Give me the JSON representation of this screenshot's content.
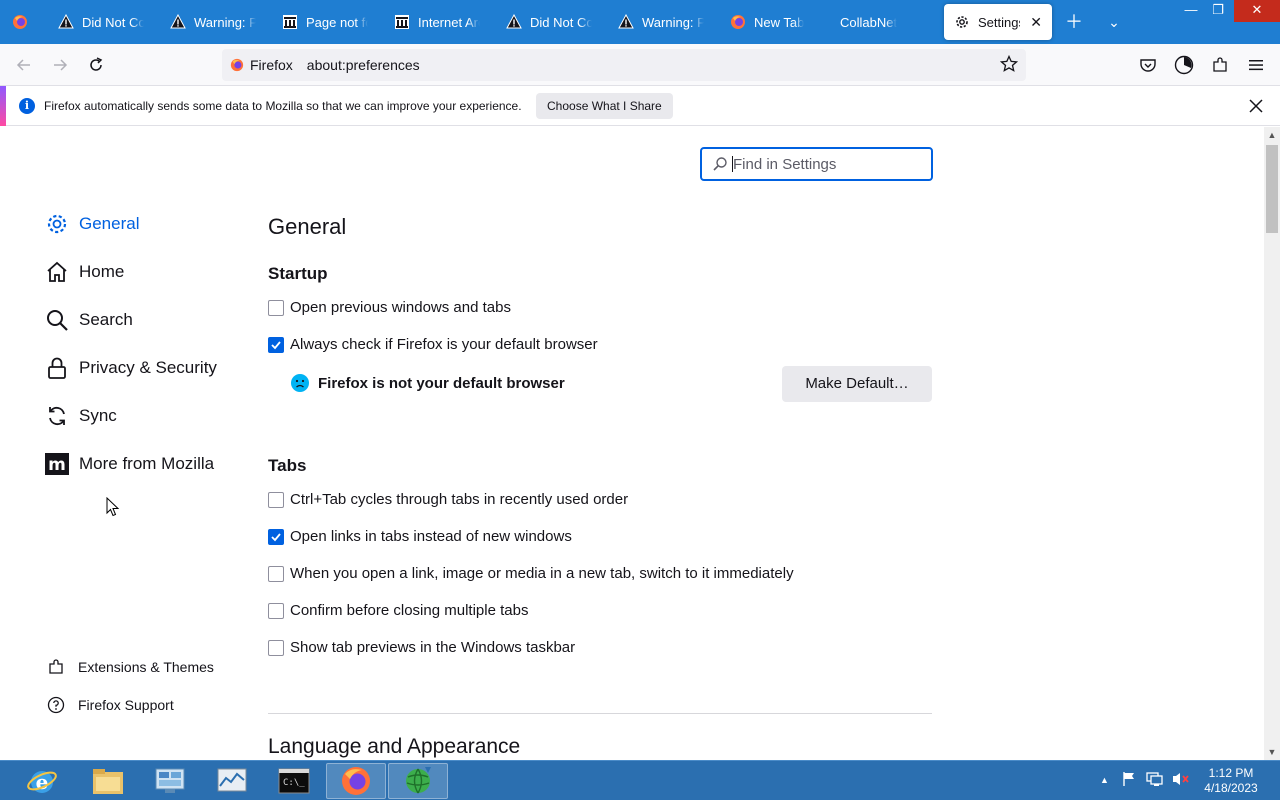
{
  "tabs": [
    {
      "label": "",
      "icon": "firefox-icon"
    },
    {
      "label": "Did Not Con",
      "icon": "warning-icon"
    },
    {
      "label": "Warning: Po",
      "icon": "warning-icon"
    },
    {
      "label": "Page not fou",
      "icon": "archive-icon"
    },
    {
      "label": "Internet Arch",
      "icon": "archive-icon"
    },
    {
      "label": "Did Not Con",
      "icon": "warning-icon"
    },
    {
      "label": "Warning: Po",
      "icon": "warning-icon"
    },
    {
      "label": "New Tab",
      "icon": "firefox-icon"
    },
    {
      "label": "CollabNet",
      "icon": "none"
    },
    {
      "label": "Settings",
      "icon": "gear-icon",
      "active": true
    }
  ],
  "urlbar": {
    "identity_label": "Firefox",
    "url": "about:preferences"
  },
  "notification": {
    "text": "Firefox automatically sends some data to Mozilla so that we can improve your experience.",
    "button": "Choose What I Share"
  },
  "search": {
    "placeholder": "Find in Settings"
  },
  "sidebar": {
    "items": [
      {
        "label": "General",
        "icon": "gear-icon",
        "selected": true
      },
      {
        "label": "Home",
        "icon": "home-icon"
      },
      {
        "label": "Search",
        "icon": "search-icon"
      },
      {
        "label": "Privacy & Security",
        "icon": "lock-icon"
      },
      {
        "label": "Sync",
        "icon": "sync-icon"
      },
      {
        "label": "More from Mozilla",
        "icon": "mozilla-icon"
      }
    ],
    "footer": [
      {
        "label": "Extensions & Themes",
        "icon": "puzzle-icon"
      },
      {
        "label": "Firefox Support",
        "icon": "help-icon"
      }
    ]
  },
  "main": {
    "title": "General",
    "startup": {
      "heading": "Startup",
      "options": [
        {
          "label": "Open previous windows and tabs",
          "checked": false
        },
        {
          "label": "Always check if Firefox is your default browser",
          "checked": true
        }
      ],
      "default_note": "Firefox is not your default browser",
      "make_default": "Make Default…"
    },
    "tabs_section": {
      "heading": "Tabs",
      "options": [
        {
          "label": "Ctrl+Tab cycles through tabs in recently used order",
          "checked": false
        },
        {
          "label": "Open links in tabs instead of new windows",
          "checked": true
        },
        {
          "label": "When you open a link, image or media in a new tab, switch to it immediately",
          "checked": false
        },
        {
          "label": "Confirm before closing multiple tabs",
          "checked": false
        },
        {
          "label": "Show tab previews in the Windows taskbar",
          "checked": false
        }
      ]
    },
    "next_section": "Language and Appearance"
  },
  "taskbar": {
    "clock_time": "1:12 PM",
    "clock_date": "4/18/2023"
  },
  "colors": {
    "tabstrip": "#1f7ed2",
    "accent": "#0061e0",
    "taskbar": "#2b6fb0"
  }
}
